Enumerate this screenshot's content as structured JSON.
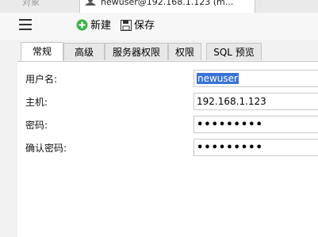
{
  "doc_tabs": {
    "inactive_label": "对象",
    "active_label": "newuser@192.168.1.123 (m..."
  },
  "toolbar": {
    "new_label": "新建",
    "save_label": "保存"
  },
  "property_tabs": [
    "常规",
    "高级",
    "服务器权限",
    "权限",
    "SQL 预览"
  ],
  "form": {
    "username_label": "用户名:",
    "username_value": "newuser",
    "host_label": "主机:",
    "host_value": "192.168.1.123",
    "password_label": "密码:",
    "password_value": "•••••••••",
    "confirm_label": "确认密码:",
    "confirm_value": "•••••••••"
  },
  "colors": {
    "selection": "#3a73d6",
    "new_icon": "#3bb34a"
  }
}
